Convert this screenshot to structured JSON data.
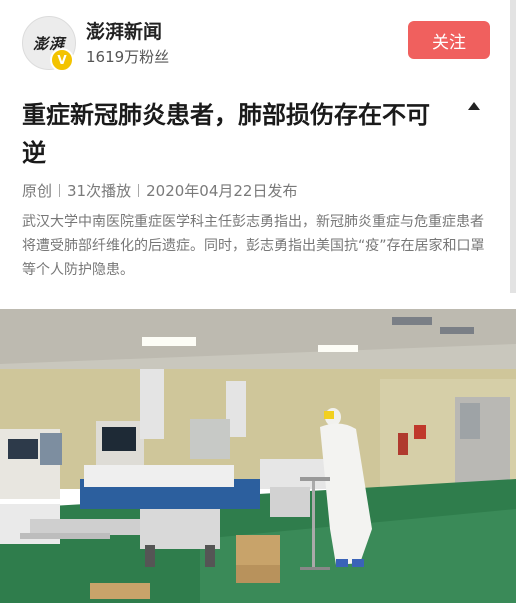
{
  "author": {
    "avatar_text": "澎湃",
    "name": "澎湃新闻",
    "followers": "1619万粉丝",
    "follow_label": "关注"
  },
  "article": {
    "title": "重症新冠肺炎患者，肺部损伤存在不可逆",
    "meta": {
      "tag": "原创",
      "plays": "31次播放",
      "date": "2020年04月22日发布"
    },
    "summary": "武汉大学中南医院重症医学科主任彭志勇指出，新冠肺炎重症与危重症患者将遭受肺部纤维化的后遗症。同时，彭志勇指出美国抗“疫”存在居家和口罩等个人防护隐患。"
  },
  "colors": {
    "follow_button": "#f0605e",
    "verified_badge": "#f3c300",
    "ward_floor": "#2f7d4c",
    "ward_wall": "#cfc69a"
  },
  "icons": {
    "collapse": "caret-up-icon",
    "verified": "verified-v-icon"
  }
}
